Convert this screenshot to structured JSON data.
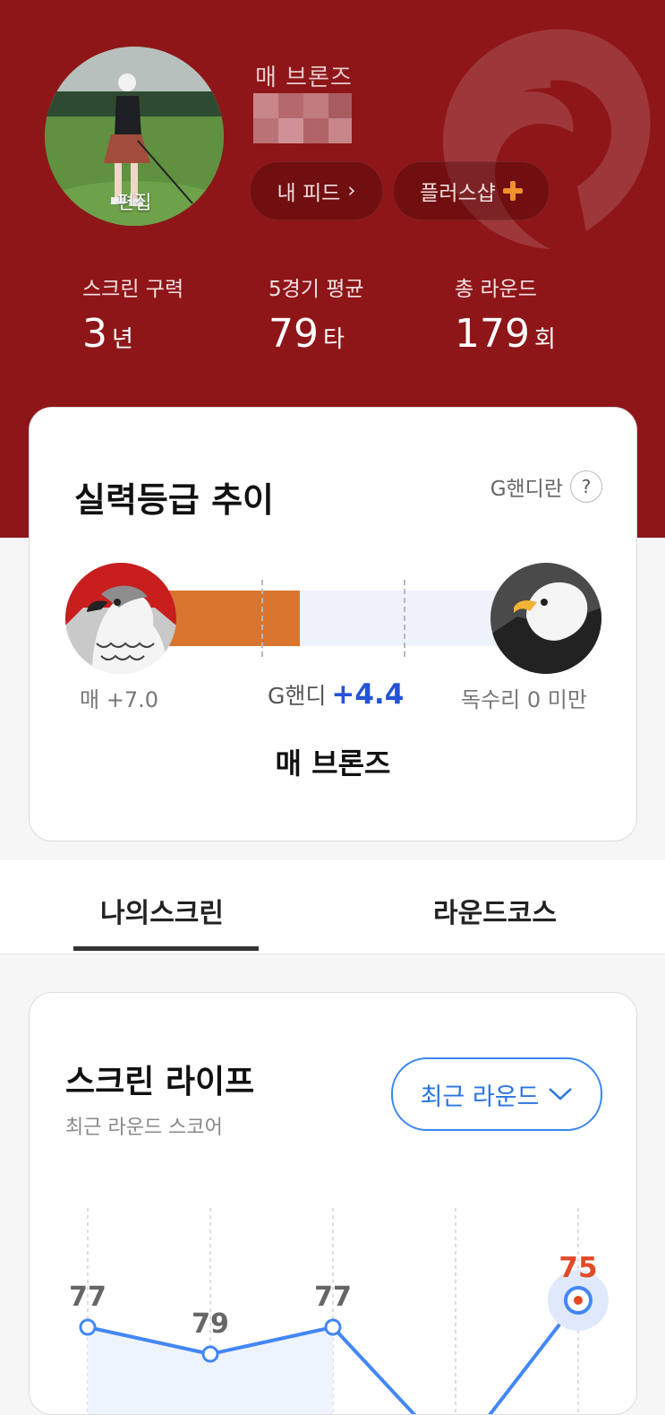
{
  "profile": {
    "avatar_edit_label": "편집",
    "grade_name": "매 브론즈",
    "feed_button": "내 피드",
    "feed_chevron": "›",
    "shop_button": "플러스샵",
    "shop_icon": "plus-icon"
  },
  "stats": [
    {
      "label": "스크린 구력",
      "value": "3",
      "unit": "년"
    },
    {
      "label": "5경기 평균",
      "value": "79",
      "unit": "타"
    },
    {
      "label": "총 라운드",
      "value": "179",
      "unit": "회"
    }
  ],
  "grade_card": {
    "title": "실력등급 추이",
    "help_label": "G핸디란",
    "help_icon": "?",
    "left_label": "매  +7.0",
    "right_label": "독수리  0 미만",
    "current_prefix": "G핸디",
    "current_value": "+4.4",
    "current_grade": "매 브론즈",
    "progress_fraction": 0.4
  },
  "tabs": [
    {
      "label": "나의스크린",
      "active": true
    },
    {
      "label": "라운드코스",
      "active": false
    }
  ],
  "life_card": {
    "title": "스크린 라이프",
    "subtitle": "최근 라운드 스코어",
    "select_label": "최근 라운드",
    "select_icon": "chevron-down-icon"
  },
  "chart_data": {
    "type": "line",
    "x": [
      1,
      2,
      3,
      4,
      5
    ],
    "values": [
      77,
      79,
      77,
      null,
      75
    ],
    "labels": [
      "77",
      "79",
      "77",
      "",
      "75"
    ],
    "highlight_index": 4,
    "colors": {
      "line": "#4287f5",
      "highlight": "#e24a26",
      "label": "#666666"
    }
  },
  "colors": {
    "hero": "#8e1619",
    "progress": "#d9752e",
    "accent_blue": "#2353d6",
    "plus": "#f0922b"
  }
}
